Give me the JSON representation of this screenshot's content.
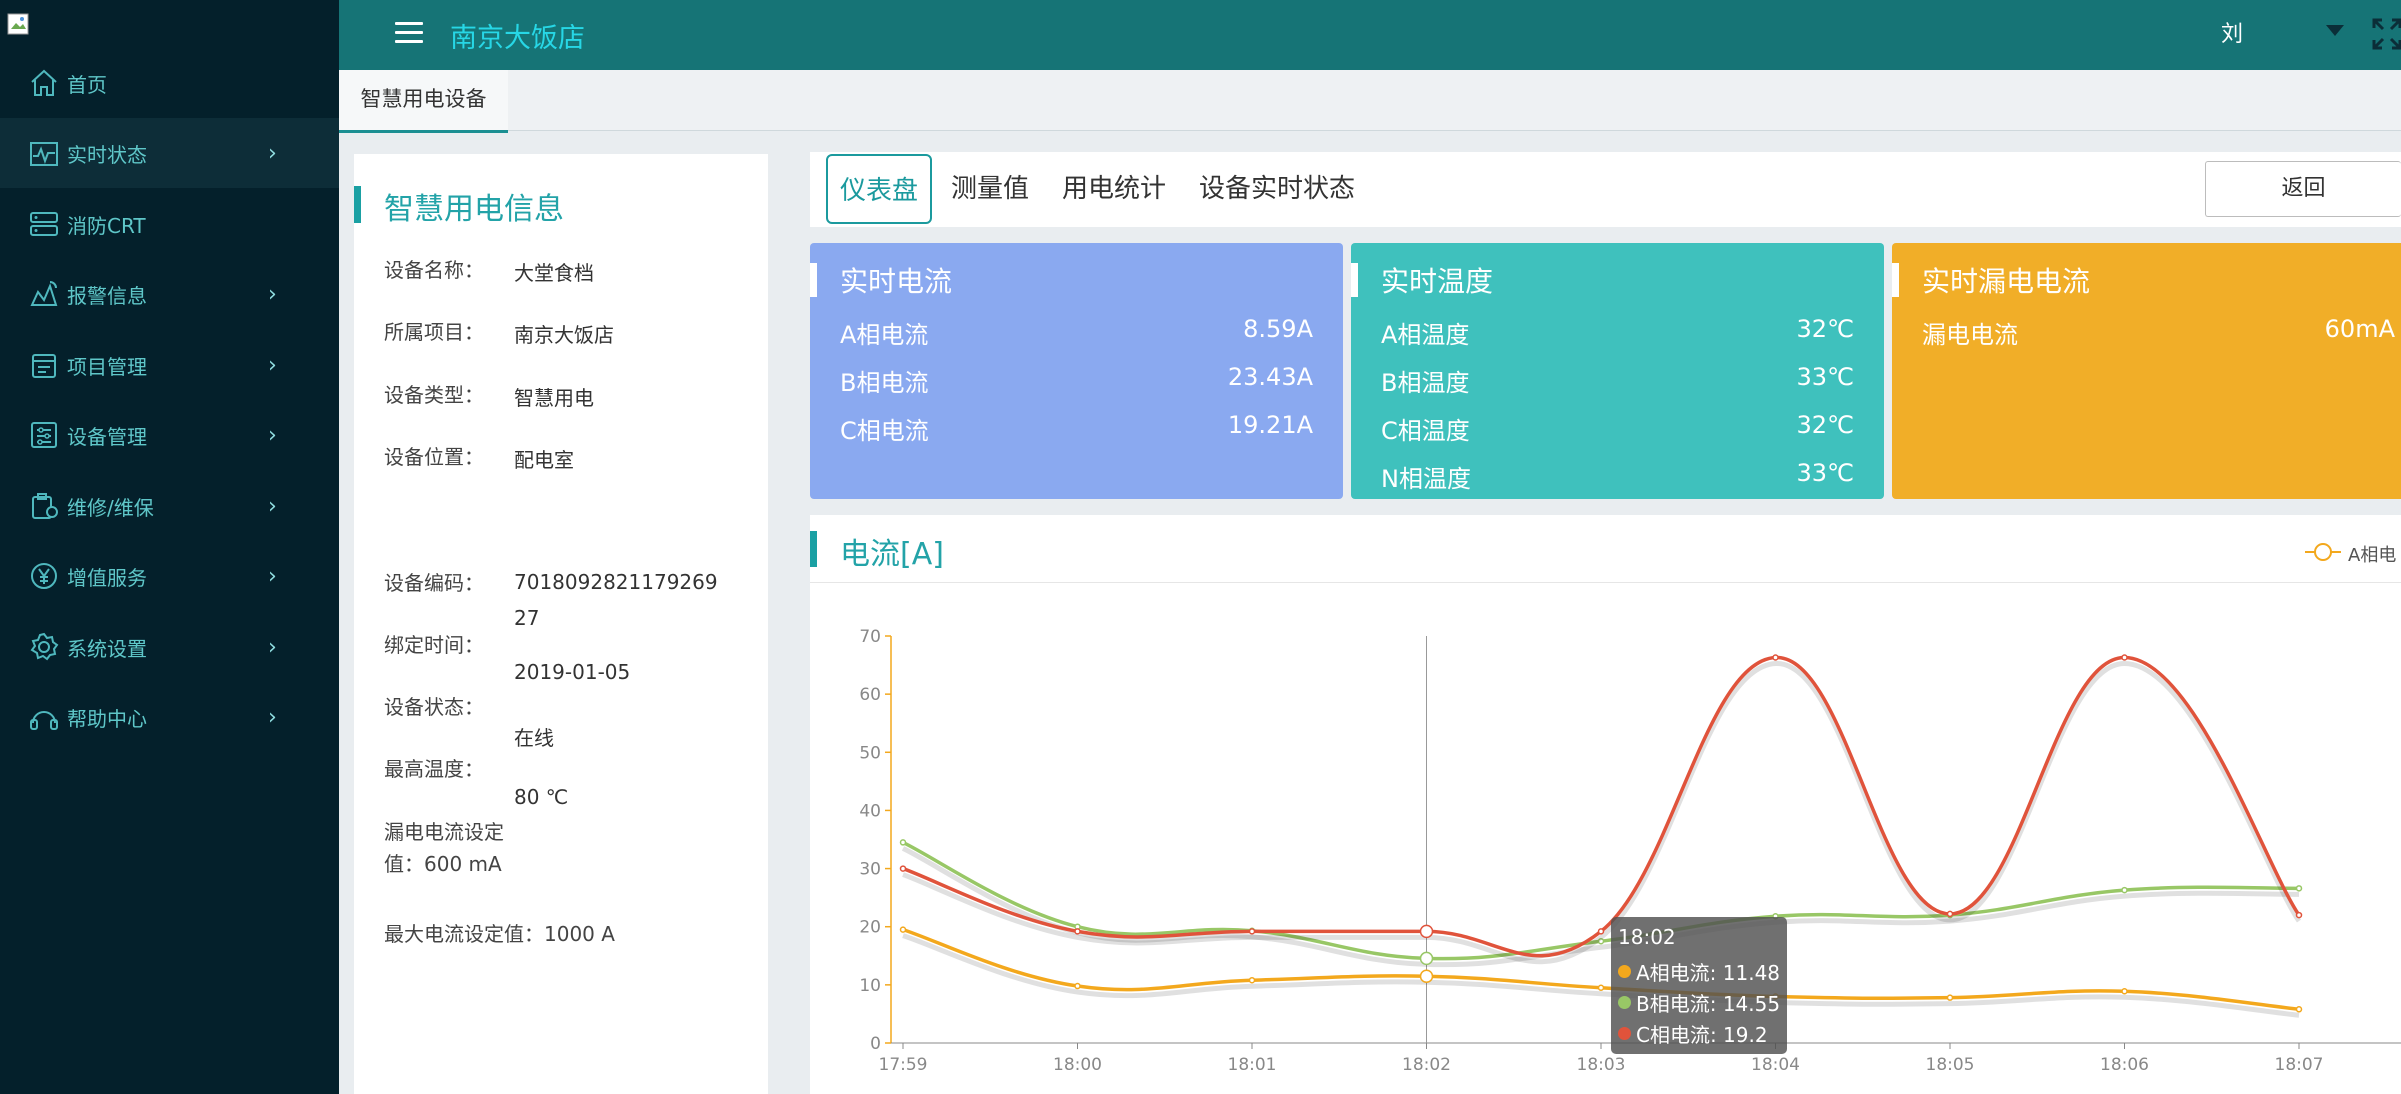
{
  "site": {
    "title": "南京大饭店"
  },
  "user": {
    "name": "刘"
  },
  "sidebar": {
    "items": [
      {
        "label": "首页",
        "icon": "home-icon",
        "arrow": ""
      },
      {
        "label": "实时状态",
        "icon": "pulse-icon",
        "arrow": "›"
      },
      {
        "label": "消防CRT",
        "icon": "server-icon",
        "arrow": ""
      },
      {
        "label": "报警信息",
        "icon": "alarm-icon",
        "arrow": "›"
      },
      {
        "label": "项目管理",
        "icon": "project-icon",
        "arrow": "›"
      },
      {
        "label": "设备管理",
        "icon": "device-icon",
        "arrow": "›"
      },
      {
        "label": "维修/维保",
        "icon": "repair-icon",
        "arrow": "›"
      },
      {
        "label": "增值服务",
        "icon": "yuan-icon",
        "arrow": "›"
      },
      {
        "label": "系统设置",
        "icon": "gear-icon",
        "arrow": "›"
      },
      {
        "label": "帮助中心",
        "icon": "help-icon",
        "arrow": "›"
      }
    ]
  },
  "page_tab": {
    "label": "智慧用电设备"
  },
  "info": {
    "title": "智慧用电信息",
    "device_name_label": "设备名称：",
    "device_name": "大堂食档",
    "project_label": "所属项目：",
    "project": "南京大饭店",
    "type_label": "设备类型：",
    "type": "智慧用电",
    "location_label": "设备位置：",
    "location": "配电室",
    "code_label": "设备编码：",
    "code_line1": "7018092821179269",
    "code_line2": "27",
    "bind_label": "绑定时间：",
    "bind_time": "2019-01-05",
    "status_label": "设备状态：",
    "status": "在线",
    "max_temp_label": "最高温度：",
    "max_temp": "80 ℃",
    "leak_label_line1": "漏电电流设定",
    "leak_label_line2": "值：600 mA",
    "max_current": "最大电流设定值：1000 A"
  },
  "main_tabs": [
    "仪表盘",
    "测量值",
    "用电统计",
    "设备实时状态"
  ],
  "back_button": "返回",
  "cards": {
    "current": {
      "title": "实时电流",
      "color": "#8aa9f0",
      "rows": [
        {
          "label": "A相电流",
          "value": "8.59A"
        },
        {
          "label": "B相电流",
          "value": "23.43A"
        },
        {
          "label": "C相电流",
          "value": "19.21A"
        }
      ]
    },
    "temperature": {
      "title": "实时温度",
      "color": "#3fc1bd",
      "rows": [
        {
          "label": "A相温度",
          "value": "32℃"
        },
        {
          "label": "B相温度",
          "value": "33℃"
        },
        {
          "label": "C相温度",
          "value": "32℃"
        },
        {
          "label": "N相温度",
          "value": "33℃"
        }
      ]
    },
    "leakage": {
      "title": "实时漏电电流",
      "color": "#f1ae28",
      "rows": [
        {
          "label": "漏电电流",
          "value": "60mA"
        }
      ]
    }
  },
  "chart_data": {
    "type": "line",
    "title": "电流[A]",
    "categories": [
      "17:59",
      "18:00",
      "18:01",
      "18:02",
      "18:03",
      "18:04",
      "18:05",
      "18:06",
      "18:07"
    ],
    "ylim": [
      0,
      70
    ],
    "yticks": [
      0,
      10,
      20,
      30,
      40,
      50,
      60,
      70
    ],
    "legend_visible": "A相电",
    "series": [
      {
        "name": "A相电流",
        "color": "#f3a81d",
        "values": [
          19.5,
          9.8,
          10.8,
          11.48,
          9.5,
          8.0,
          7.8,
          8.9,
          5.8
        ]
      },
      {
        "name": "B相电流",
        "color": "#98c766",
        "values": [
          34.5,
          20.0,
          19.3,
          14.55,
          17.5,
          21.8,
          22.0,
          26.3,
          26.6
        ]
      },
      {
        "name": "C相电流",
        "color": "#e0533b",
        "values": [
          30.0,
          19.2,
          19.2,
          19.2,
          19.2,
          66.3,
          22.2,
          66.3,
          22.0
        ]
      }
    ],
    "tooltip": {
      "time": "18:02",
      "rows": [
        {
          "label": "A相电流: 11.48"
        },
        {
          "label": "B相电流: 14.55"
        },
        {
          "label": "C相电流: 19.2"
        }
      ]
    },
    "hover_index": 3
  }
}
